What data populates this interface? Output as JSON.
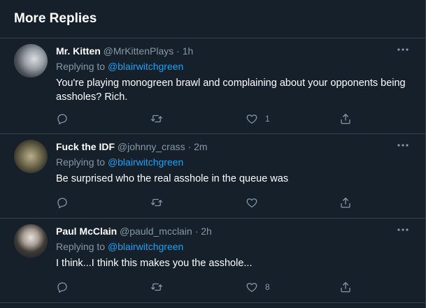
{
  "section": {
    "title": "More Replies"
  },
  "replying_prefix": "Replying to",
  "tweets": [
    {
      "name": "Mr. Kitten",
      "handle": "@MrKittenPlays",
      "separator": "·",
      "time": "1h",
      "replying_to": "@blairwitchgreen",
      "text": "You're playing monogreen brawl and complaining about your opponents being assholes? Rich.",
      "reply_count": "",
      "retweet_count": "",
      "like_count": "1"
    },
    {
      "name": "Fuck the IDF",
      "handle": "@johnny_crass",
      "separator": "·",
      "time": "2m",
      "replying_to": "@blairwitchgreen",
      "text": "Be surprised who the real asshole in the queue was",
      "reply_count": "",
      "retweet_count": "",
      "like_count": ""
    },
    {
      "name": "Paul McClain",
      "handle": "@pauld_mcclain",
      "separator": "·",
      "time": "2h",
      "replying_to": "@blairwitchgreen",
      "text": "I think...I think this makes you the asshole...",
      "reply_count": "",
      "retweet_count": "",
      "like_count": "8"
    }
  ],
  "icons": {
    "more": "more-horizontal-icon",
    "reply": "reply-icon",
    "retweet": "retweet-icon",
    "like": "heart-icon",
    "share": "share-icon"
  },
  "colors": {
    "background": "#15202b",
    "border": "#38444d",
    "secondary_text": "#8899a6",
    "link": "#1da1f2"
  }
}
